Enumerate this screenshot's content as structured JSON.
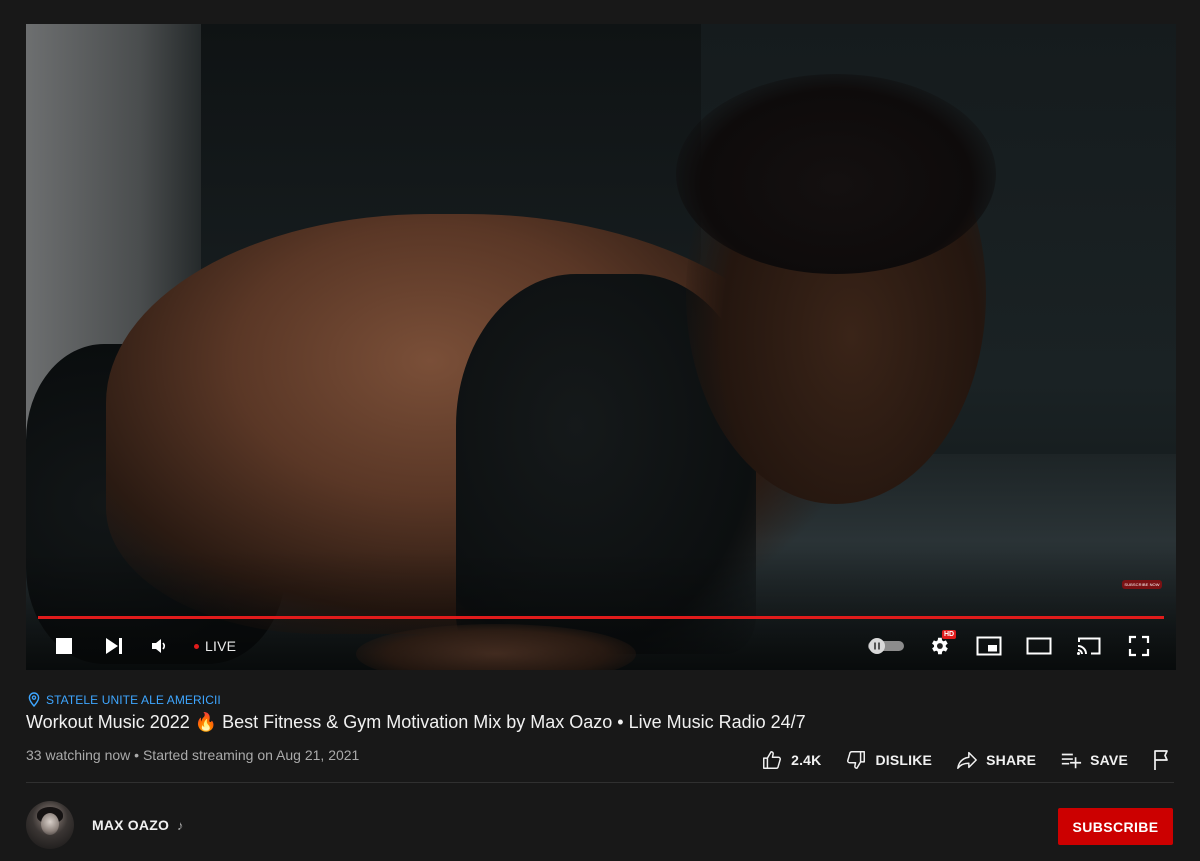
{
  "player": {
    "overlay_subscribe": "SUBSCRIBE NOW",
    "live_label": "LIVE",
    "hd_badge": "HD",
    "progress_fraction": 1.0,
    "accent_color": "#e01b1b",
    "controls": {
      "left": [
        "stop-icon",
        "next-icon",
        "volume-icon"
      ],
      "right": [
        "autoplay-toggle",
        "settings-icon",
        "miniplayer-icon",
        "theater-mode-icon",
        "cast-icon",
        "fullscreen-icon"
      ]
    }
  },
  "video": {
    "location": "STATELE UNITE ALE AMERICII",
    "title": "Workout Music 2022 🔥  Best Fitness & Gym Motivation Mix by Max Oazo • Live Music Radio 24/7",
    "meta": "33 watching now • Started streaming on Aug 21, 2021"
  },
  "actions": {
    "like": "2.4K",
    "dislike": "DISLIKE",
    "share": "SHARE",
    "save": "SAVE",
    "report_icon": "flag-icon"
  },
  "channel": {
    "name": "MAX OAZO",
    "badge_icon": "music-note-icon",
    "subscribe_label": "SUBSCRIBE",
    "subscribe_color": "#cc0000"
  }
}
